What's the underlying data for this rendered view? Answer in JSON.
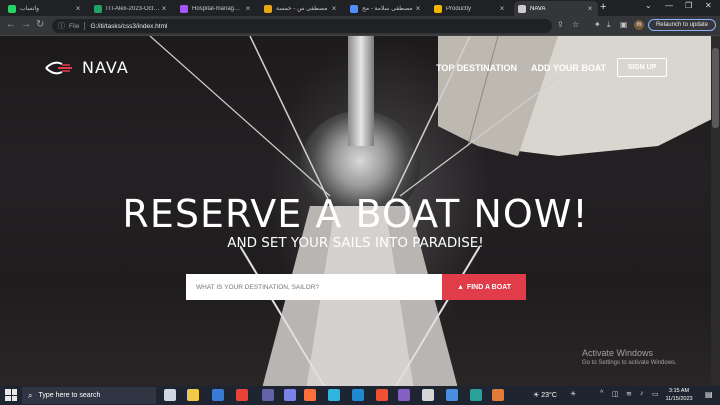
{
  "browser": {
    "tabs": [
      {
        "title": "واتساب",
        "color": "#25d366",
        "active": false
      },
      {
        "title": "ITI-Alex-2023-Oct - Goo",
        "color": "#1fa463",
        "active": false
      },
      {
        "title": "Hospital-managment",
        "color": "#a259ff",
        "active": false
      },
      {
        "title": "مصطفى س - خمسة",
        "color": "#e6a817",
        "active": false
      },
      {
        "title": "مصطفى سلامة - مح",
        "color": "#4d90fe",
        "active": false
      },
      {
        "title": "Productly",
        "color": "#f4b400",
        "active": false
      },
      {
        "title": "NAVA",
        "color": "#cccccc",
        "active": true
      }
    ],
    "new_tab": "+",
    "window_controls": [
      "⌄",
      "—",
      "❐",
      "✕"
    ],
    "address": {
      "file_label": "File",
      "url": "G:/iti/tasks/css3/index.html"
    },
    "profile_initial": "m",
    "relaunch_label": "Relaunch to update"
  },
  "page": {
    "logo_text": "NAVA",
    "nav": {
      "top_destination": "TOP DESTINATION",
      "add_your_boat": "ADD YOUR BOAT",
      "sign_up": "SIGN UP"
    },
    "hero": {
      "title": "RESERVE A BOAT NOW!",
      "subtitle": "AND SET YOUR SAILS INTO PARADISE!"
    },
    "search": {
      "placeholder": "WHAT IS YOUR DESTINATION, SAILOR?",
      "button_label": "FIND A BOAT"
    },
    "watermark": {
      "line1": "Activate Windows",
      "line2": "Go to Settings to activate Windows."
    }
  },
  "taskbar": {
    "search_placeholder": "Type here to search",
    "weather": "23°C",
    "clock_time": "3:15 AM",
    "clock_date": "11/15/2023",
    "apps": [
      {
        "icon": "task-view-icon",
        "color": "#cfd8e3"
      },
      {
        "icon": "file-explorer-icon",
        "color": "#f2c84b"
      },
      {
        "icon": "mail-icon",
        "color": "#3a7bd5"
      },
      {
        "icon": "chrome-icon",
        "color": "#ea4335"
      },
      {
        "icon": "teams-icon",
        "color": "#6264a7"
      },
      {
        "icon": "teams-icon",
        "color": "#7b83eb"
      },
      {
        "icon": "firefox-icon",
        "color": "#ff7139"
      },
      {
        "icon": "edge-icon",
        "color": "#2fb5e0"
      },
      {
        "icon": "vscode-icon",
        "color": "#1f8ad2"
      },
      {
        "icon": "git-icon",
        "color": "#f05033"
      },
      {
        "icon": "visual-studio-icon",
        "color": "#865fc5"
      },
      {
        "icon": "obs-icon",
        "color": "#d6d6d6"
      },
      {
        "icon": "app-icon",
        "color": "#4a90e2"
      },
      {
        "icon": "app-icon",
        "color": "#2aa198"
      },
      {
        "icon": "app-icon",
        "color": "#e07b39"
      }
    ]
  }
}
